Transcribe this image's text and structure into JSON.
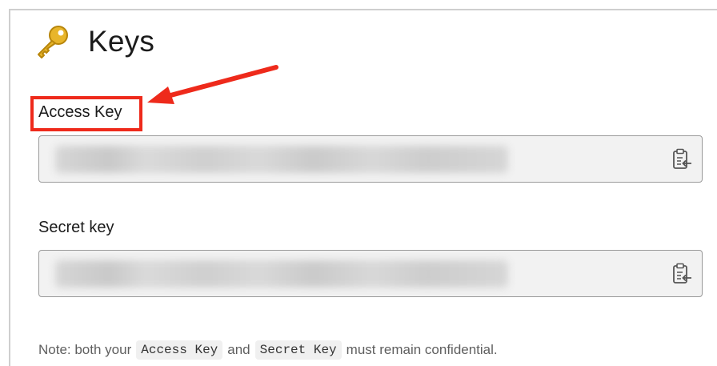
{
  "page": {
    "title": "Keys",
    "title_icon": "key-icon"
  },
  "fields": {
    "access": {
      "label": "Access Key",
      "copy_icon": "clipboard-copy-icon"
    },
    "secret": {
      "label": "Secret key",
      "copy_icon": "clipboard-copy-icon"
    }
  },
  "note": {
    "prefix": "Note: both your",
    "code1": "Access Key",
    "middle": "and",
    "code2": "Secret Key",
    "suffix": "must remain confidential."
  },
  "annotation": {
    "highlight_color": "#ee2a1b",
    "arrow_icon": "red-arrow-icon"
  }
}
